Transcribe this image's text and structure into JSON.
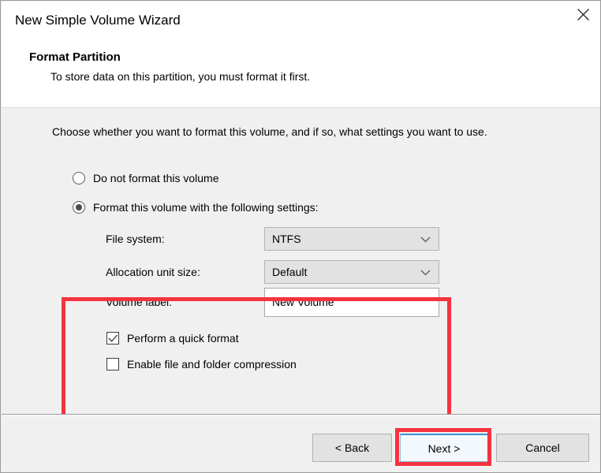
{
  "window": {
    "title": "New Simple Volume Wizard",
    "close_icon": "close-icon"
  },
  "header": {
    "title": "Format Partition",
    "subtitle": "To store data on this partition, you must format it first."
  },
  "main": {
    "instruction": "Choose whether you want to format this volume, and if so, what settings you want to use.",
    "radios": [
      {
        "label": "Do not format this volume",
        "checked": false
      },
      {
        "label": "Format this volume with the following settings:",
        "checked": true
      }
    ],
    "fields": [
      {
        "label": "File system:",
        "value": "NTFS",
        "type": "combobox",
        "chevron_icon": "chevron-down-icon"
      },
      {
        "label": "Allocation unit size:",
        "value": "Default",
        "type": "combobox",
        "chevron_icon": "chevron-down-icon"
      },
      {
        "label": "Volume label:",
        "value": "New Volume",
        "type": "textbox",
        "placeholder": ""
      }
    ],
    "checkboxes": [
      {
        "label": "Perform a quick format",
        "checked": true,
        "check_icon": "checkmark-icon"
      },
      {
        "label": "Enable file and folder compression",
        "checked": false,
        "check_icon": "checkmark-icon"
      }
    ]
  },
  "footer": {
    "back_label": "< Back",
    "next_label": "Next >",
    "cancel_label": "Cancel"
  },
  "annotations": {
    "color": "#f5333f",
    "targets": [
      "format-settings-group",
      "next-button"
    ]
  }
}
